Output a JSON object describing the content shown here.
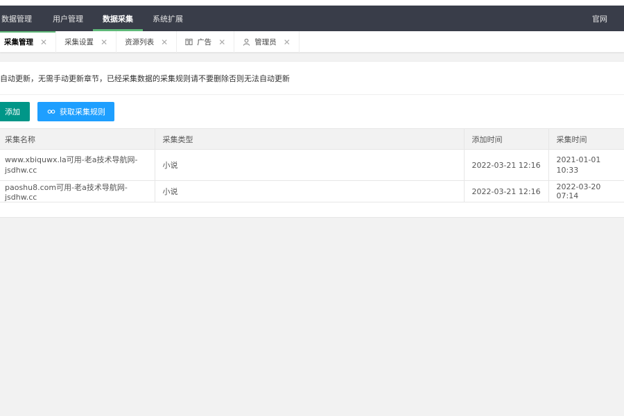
{
  "topnav": {
    "items": [
      "数据管理",
      "用户管理",
      "数据采集",
      "系统扩展"
    ],
    "active_index": 2,
    "right_link": "官网"
  },
  "tabs": [
    {
      "label": "采集管理",
      "icon": "",
      "active": true
    },
    {
      "label": "采集设置",
      "icon": ""
    },
    {
      "label": "资源列表",
      "icon": ""
    },
    {
      "label": "广告",
      "icon": "book-icon"
    },
    {
      "label": "管理员",
      "icon": "user-icon"
    }
  ],
  "notice": "自动更新，无需手动更新章节，已经采集数据的采集规则请不要删除否则无法自动更新",
  "buttons": {
    "add_label": "添加",
    "fetch_label": "获取采集规则",
    "add_color": "#009688",
    "fetch_color": "#1e9fff"
  },
  "table": {
    "headers": [
      "采集名称",
      "采集类型",
      "添加时间",
      "采集时间"
    ],
    "rows": [
      [
        "www.xbiquwx.la可用-老a技术导航网-jsdhw.cc",
        "小说",
        "2022-03-21 12:16",
        "2021-01-01 10:33"
      ],
      [
        "paoshu8.com可用-老a技术导航网-jsdhw.cc",
        "小说",
        "2022-03-21 12:16",
        "2022-03-20 07:14"
      ]
    ]
  },
  "colors": {
    "topnav_bg": "#393d49",
    "accent": "#5fb878"
  }
}
